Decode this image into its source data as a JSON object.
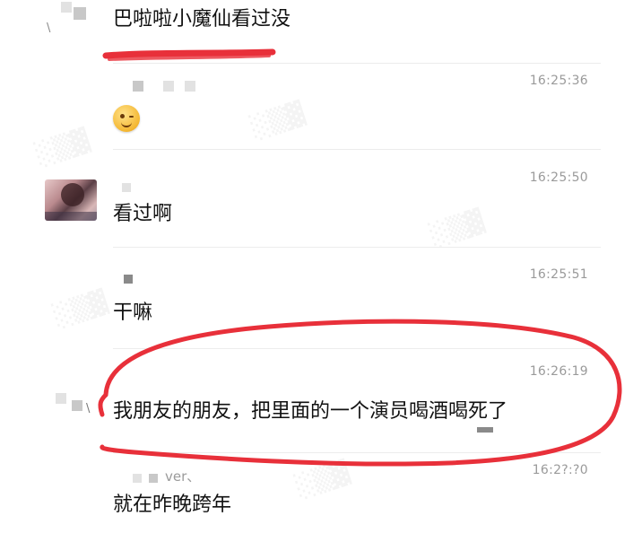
{
  "messages": [
    {
      "text": "巴啦啦小魔仙看过没",
      "time": "",
      "sender": ""
    },
    {
      "text": "",
      "time": "16:25:36",
      "sender": ""
    },
    {
      "text": "看过啊",
      "time": "16:25:50",
      "sender": ""
    },
    {
      "text": "干嘛",
      "time": "16:25:51",
      "sender": ""
    },
    {
      "text": "我朋友的朋友，把里面的一个演员喝酒喝死了",
      "time": "16:26:19",
      "sender": ""
    },
    {
      "text": "就在昨晚跨年",
      "time": "16:2?:?0",
      "sender": "ver、"
    }
  ],
  "colors": {
    "annotation_red": "#e8303a",
    "time_gray": "#9a9a9a",
    "divider": "#ececec"
  },
  "icons": {
    "emoji": "wink-emoji-icon"
  }
}
